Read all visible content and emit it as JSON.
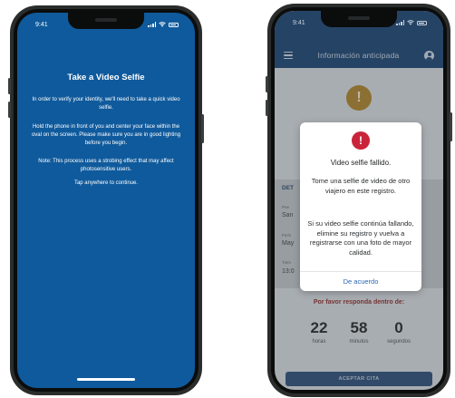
{
  "left_screen": {
    "status_time": "9:41",
    "title": "Take a Video Selfie",
    "paragraphs": [
      "In order to verify your identity, we'll need to take a quick video selfie.",
      "Hold the phone in front of you and center your face within the oval on the screen.  Please make sure you are in good lighting before you begin.",
      "Note: This process uses a strobing effect that may affect photosensitive users.",
      "Tap anywhere to continue."
    ],
    "colors": {
      "background": "#0f5a9c",
      "text": "#ffffff"
    }
  },
  "right_screen": {
    "status_time": "9:41",
    "header_title": "Información anticipada",
    "icons": {
      "menu": "menu-icon",
      "account": "user-icon",
      "background_alert": "exclamation-icon",
      "modal_alert": "exclamation-icon"
    },
    "background": {
      "card_heading": "DET",
      "fragments": [
        "Pue",
        "San",
        "Fech",
        "May",
        "Tiem",
        "13:0"
      ],
      "respond_label": "Por favor responda dentro de:",
      "countdown": [
        {
          "value": "22",
          "label": "horas"
        },
        {
          "value": "58",
          "label": "minutos"
        },
        {
          "value": "0",
          "label": "segundos"
        }
      ],
      "accept_button": "ACEPTAR CITA"
    },
    "modal": {
      "title": "Video selfie fallido.",
      "body_1": "Tome una selfie de video de otro viajero en este registro.",
      "body_2": "Si su video selfie continúa fallando, elimine su registro y vuelva a registrarse con una foto de mayor calidad.",
      "confirm_button": "De acuerdo"
    },
    "colors": {
      "header": "#1a416e",
      "alert_red": "#c9243a",
      "link_blue": "#2b67b8",
      "respond_red": "#8a2a2a",
      "background_alert": "#a87d28"
    }
  }
}
